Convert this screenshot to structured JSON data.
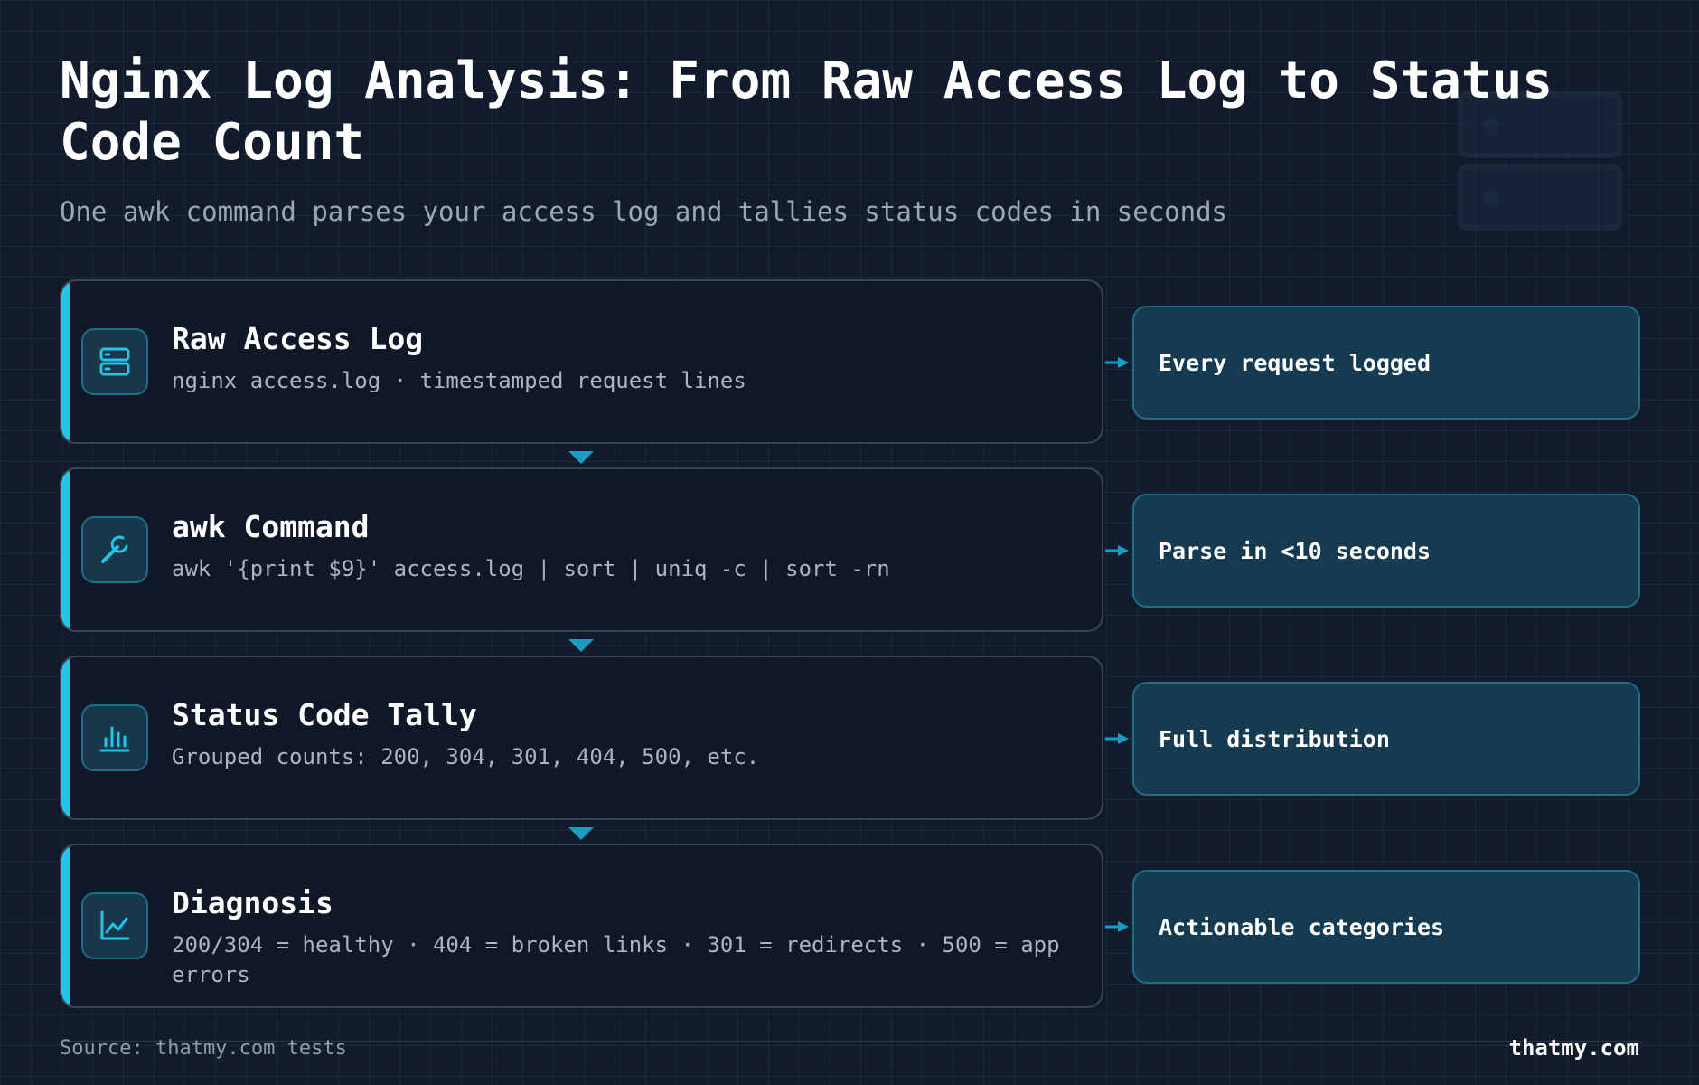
{
  "header": {
    "title": "Nginx Log Analysis: From Raw Access Log to Status Code Count",
    "subtitle": "One awk command parses your access log and tallies status codes in seconds",
    "decoration_icon": "server-icon"
  },
  "colors": {
    "background": "#121b2b",
    "accent": "#22c5e8",
    "card": "#101828",
    "badge": "#163a4f"
  },
  "steps": [
    {
      "title": "Raw Access Log",
      "description": "nginx access.log · timestamped request lines",
      "icon": "server-icon",
      "outcome": "Every request logged"
    },
    {
      "title": "awk Command",
      "description": "awk '{print $9}' access.log | sort | uniq -c | sort -rn",
      "icon": "wrench-icon",
      "outcome": "Parse in <10 seconds"
    },
    {
      "title": "Status Code Tally",
      "description": "Grouped counts: 200, 304, 301, 404, 500, etc.",
      "icon": "bar-chart-icon",
      "outcome": "Full distribution"
    },
    {
      "title": "Diagnosis",
      "description": "200/304 = healthy · 404 = broken links · 301 = redirects · 500 = app errors",
      "icon": "line-chart-icon",
      "outcome": "Actionable categories"
    }
  ],
  "footer": {
    "source": "Source: thatmy.com tests",
    "brand": "thatmy.com"
  }
}
